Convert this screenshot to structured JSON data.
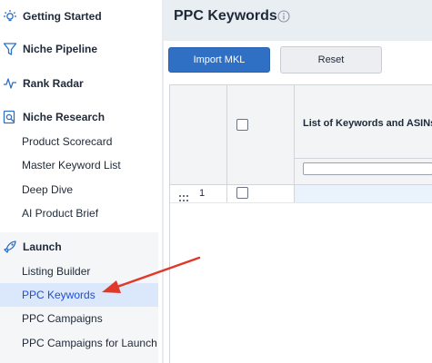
{
  "sidebar": {
    "sections": [
      {
        "label": "Getting Started",
        "icon": "lightbulb-icon"
      },
      {
        "label": "Niche Pipeline",
        "icon": "funnel-icon"
      },
      {
        "label": "Rank Radar",
        "icon": "pulse-icon"
      },
      {
        "label": "Niche Research",
        "icon": "search-document-icon",
        "items": [
          "Product Scorecard",
          "Master Keyword List",
          "Deep Dive",
          "AI Product Brief"
        ]
      },
      {
        "label": "Launch",
        "icon": "rocket-icon",
        "items": [
          "Listing Builder",
          "PPC Keywords",
          "PPC Campaigns",
          "PPC Campaigns for Launch"
        ]
      }
    ],
    "active_item": "PPC Keywords",
    "active_color": "#dbe8fb"
  },
  "header": {
    "title": "PPC Keywords",
    "info_icon": "info-icon"
  },
  "toolbar": {
    "import_label": "Import MKL",
    "reset_label": "Reset",
    "primary_color": "#2f6fc4"
  },
  "grid": {
    "column_title": "List of Keywords and ASINs",
    "filter_value": "",
    "rows": [
      {
        "number": "1"
      }
    ]
  },
  "annotation": {
    "arrow_color": "#e0392b"
  }
}
